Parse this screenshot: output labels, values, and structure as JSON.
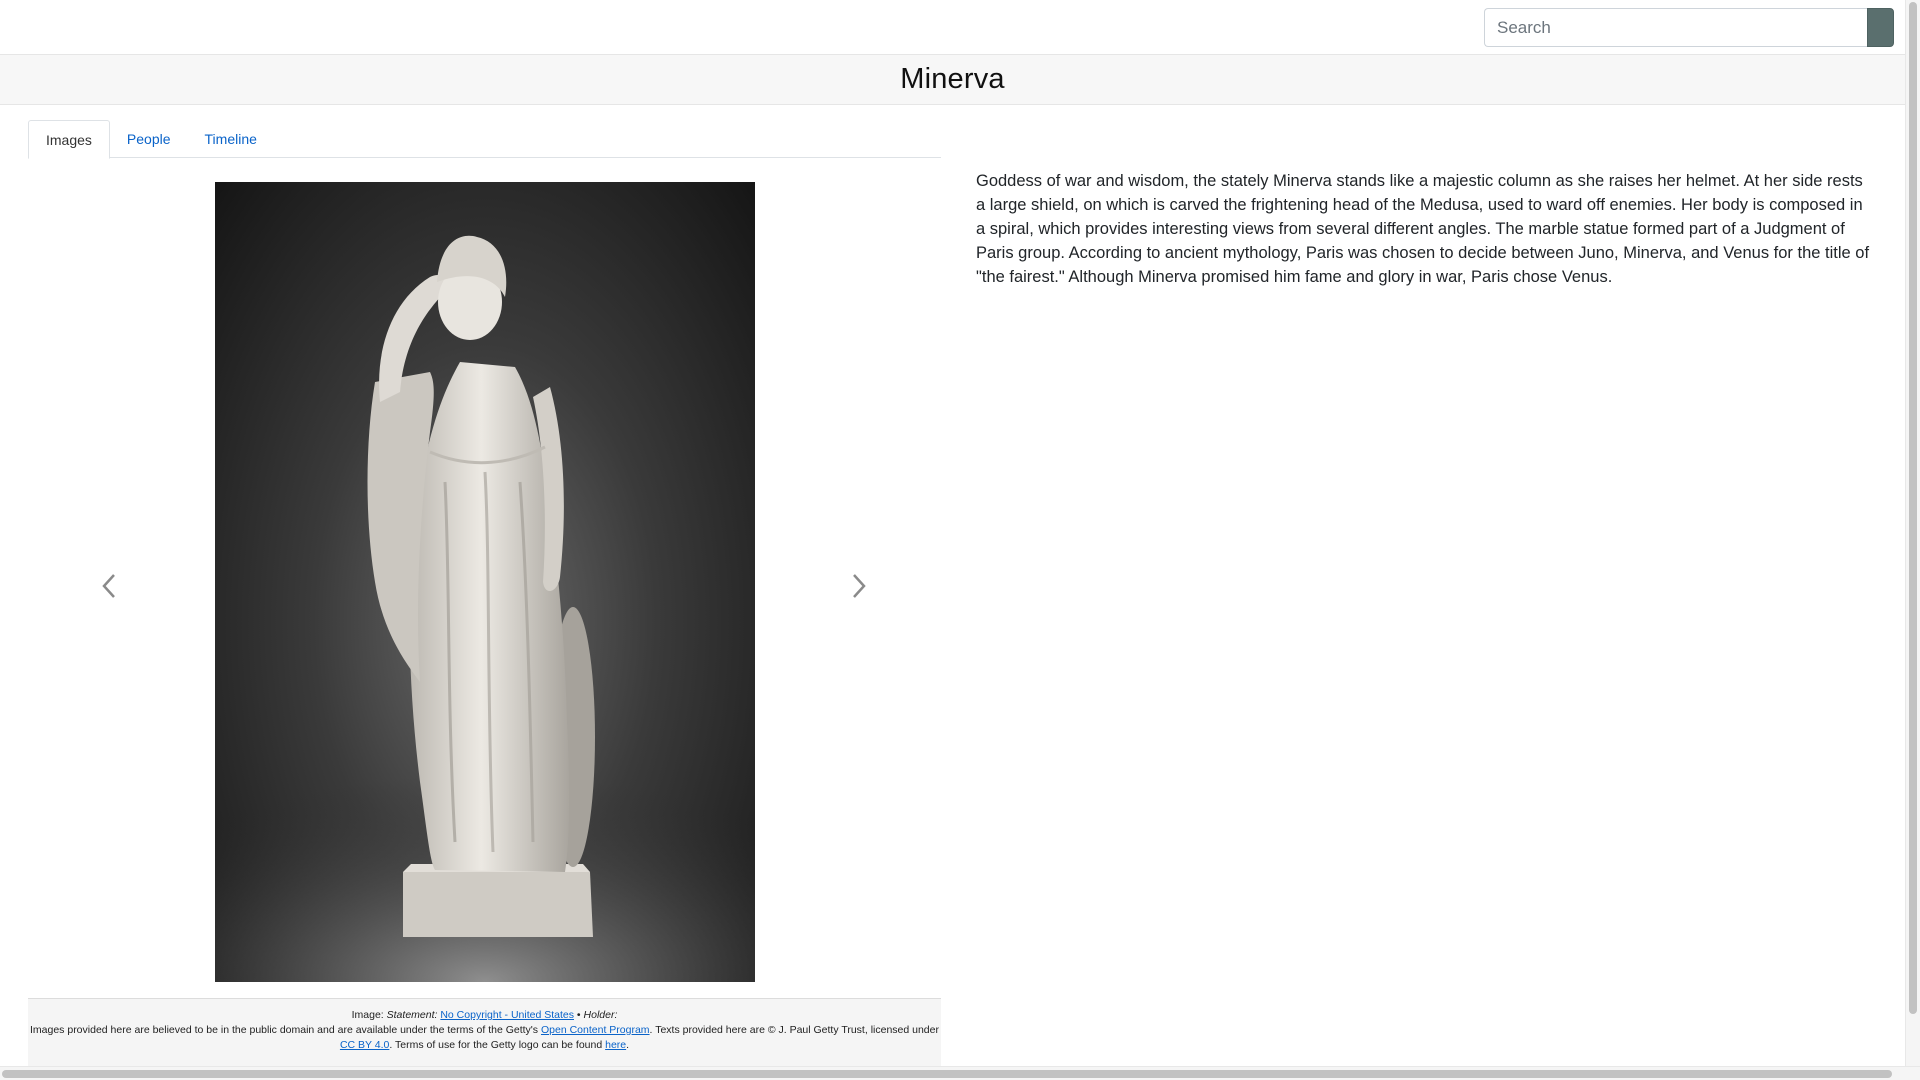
{
  "search": {
    "placeholder": "Search",
    "value": ""
  },
  "header": {
    "title": "Minerva"
  },
  "tabs": [
    {
      "label": "Images",
      "active": true
    },
    {
      "label": "People",
      "active": false
    },
    {
      "label": "Timeline",
      "active": false
    }
  ],
  "carousel": {
    "prev_icon": "chevron-left-icon",
    "next_icon": "chevron-right-icon"
  },
  "caption": {
    "image_prefix": "Image: ",
    "statement_label": "Statement:",
    "statement_link": "No Copyright - United States",
    "separator": " • ",
    "holder_label": "Holder:",
    "line2_text1": "Images provided here are believed to be in the public domain and are available under the terms of the Getty's ",
    "open_content_link": "Open Content Program",
    "line2_text2": ". Texts provided here are © J. Paul Getty Trust, licensed under ",
    "cc_link": "CC BY 4.0",
    "line2_text3": ". Terms of use for the Getty logo can be found ",
    "here_link": "here",
    "line2_text4": "."
  },
  "description": "Goddess of war and wisdom, the stately Minerva stands like a majestic column as she raises her helmet. At her side rests a large shield, on which is carved the frightening head of the Medusa, used to ward off enemies. Her body is composed in a spiral, which provides interesting views from several different angles. The marble statue formed part of a Judgment of Paris group. According to ancient mythology, Paris was chosen to decide between Juno, Minerva, and Venus for the title of \"the fairest.\" Although Minerva promised him fame and glory in war, Paris chose Venus.",
  "colors": {
    "link": "#0a63c9",
    "search_button": "#5a6f6e",
    "title_bar": "#f7f7f7"
  }
}
